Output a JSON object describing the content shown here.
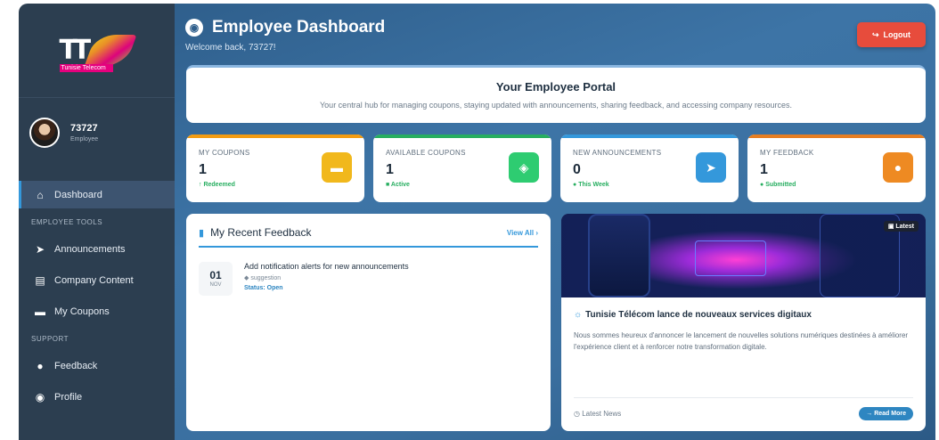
{
  "brand": {
    "logo_letters": "TT",
    "logo_text": "Tunisie Telecom"
  },
  "user": {
    "name": "73727",
    "role": "Employee"
  },
  "sidebar": {
    "items": [
      {
        "label": "Dashboard",
        "icon": "home-icon"
      },
      {
        "label": "Announcements",
        "icon": "megaphone-icon"
      },
      {
        "label": "Company Content",
        "icon": "document-icon"
      },
      {
        "label": "My Coupons",
        "icon": "ticket-icon"
      },
      {
        "label": "Feedback",
        "icon": "comment-icon"
      },
      {
        "label": "Profile",
        "icon": "user-circle-icon"
      }
    ],
    "sections": {
      "tools": "EMPLOYEE TOOLS",
      "support": "SUPPORT"
    }
  },
  "header": {
    "title": "Employee Dashboard",
    "subtitle": "Welcome back, 73727!",
    "logout_label": "Logout"
  },
  "portal": {
    "title": "Your Employee Portal",
    "subtitle": "Your central hub for managing coupons, staying updated with announcements, sharing feedback, and accessing company resources."
  },
  "stats": [
    {
      "label": "MY COUPONS",
      "value": "1",
      "foot": "Redeemed",
      "color": "#f39c12"
    },
    {
      "label": "AVAILABLE COUPONS",
      "value": "1",
      "foot": "Active",
      "color": "#27ae60"
    },
    {
      "label": "NEW ANNOUNCEMENTS",
      "value": "0",
      "foot": "This Week",
      "color": "#3498db"
    },
    {
      "label": "MY FEEDBACK",
      "value": "1",
      "foot": "Submitted",
      "color": "#e67e22"
    }
  ],
  "feedback": {
    "title": "My Recent Feedback",
    "view_all": "View All",
    "items": [
      {
        "day": "01",
        "month": "NOV",
        "title": "Add notification alerts for new announcements",
        "category": "suggestion",
        "status": "Status: Open"
      }
    ]
  },
  "news": {
    "badge": "Latest",
    "title": "Tunisie Télécom lance de nouveaux services digitaux",
    "text": "Nous sommes heureux d'annoncer le lancement de nouvelles solutions numériques destinées à améliorer l'expérience client et à renforcer notre transformation digitale.",
    "source": "Latest News",
    "read_more": "Read More"
  }
}
